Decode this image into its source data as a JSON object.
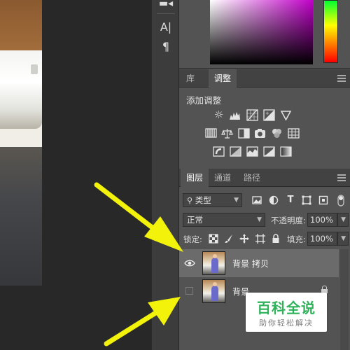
{
  "tools": {
    "type_tool_glyph": "A|",
    "paragraph_glyph": "¶"
  },
  "adjustments_panel": {
    "tabs": [
      "库",
      "调整"
    ],
    "active_tab": "调整",
    "title": "添加调整",
    "icons_row1": [
      "brightness-contrast-icon",
      "levels-icon",
      "curves-icon",
      "exposure-icon",
      "vibrance-icon"
    ],
    "icons_row2": [
      "hue-saturation-icon",
      "color-balance-icon",
      "black-white-icon",
      "photo-filter-icon",
      "channel-mixer-icon",
      "color-lookup-icon"
    ],
    "icons_row3": [
      "invert-icon",
      "posterize-icon",
      "threshold-icon",
      "selective-color-icon",
      "gradient-map-icon"
    ]
  },
  "layers_panel": {
    "tabs": [
      "图层",
      "通道",
      "路径"
    ],
    "active_tab": "图层",
    "filter_kind": "类型",
    "blend_mode": "正常",
    "opacity_label": "不透明度:",
    "opacity_value": "100%",
    "lock_label": "锁定:",
    "fill_label": "填充:",
    "fill_value": "100%",
    "layers": [
      {
        "name": "背景 拷贝",
        "visible": true,
        "selected": true,
        "locked": false
      },
      {
        "name": "背景",
        "visible": false,
        "selected": false,
        "locked": true
      }
    ]
  },
  "watermark": {
    "title": "百科全说",
    "subtitle": "助你轻松解决"
  },
  "colors": {
    "arrow": "#f2f20a",
    "watermark_green": "#2fb35a",
    "panel_bg": "#535353"
  }
}
